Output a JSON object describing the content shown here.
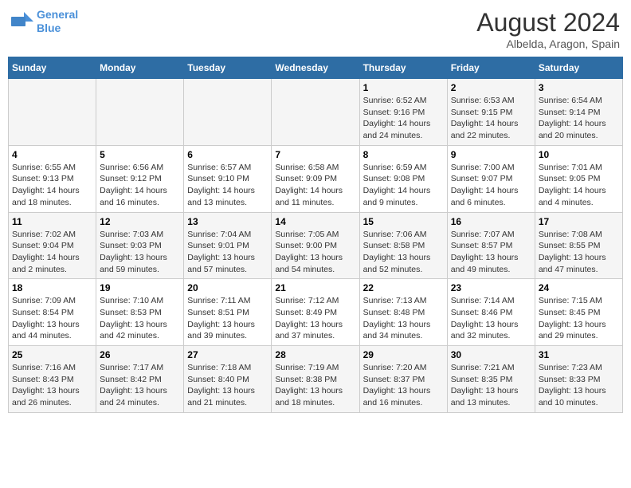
{
  "header": {
    "logo_line1": "General",
    "logo_line2": "Blue",
    "month_year": "August 2024",
    "location": "Albelda, Aragon, Spain"
  },
  "days_of_week": [
    "Sunday",
    "Monday",
    "Tuesday",
    "Wednesday",
    "Thursday",
    "Friday",
    "Saturday"
  ],
  "weeks": [
    [
      {
        "day": "",
        "info": ""
      },
      {
        "day": "",
        "info": ""
      },
      {
        "day": "",
        "info": ""
      },
      {
        "day": "",
        "info": ""
      },
      {
        "day": "1",
        "info": "Sunrise: 6:52 AM\nSunset: 9:16 PM\nDaylight: 14 hours and 24 minutes."
      },
      {
        "day": "2",
        "info": "Sunrise: 6:53 AM\nSunset: 9:15 PM\nDaylight: 14 hours and 22 minutes."
      },
      {
        "day": "3",
        "info": "Sunrise: 6:54 AM\nSunset: 9:14 PM\nDaylight: 14 hours and 20 minutes."
      }
    ],
    [
      {
        "day": "4",
        "info": "Sunrise: 6:55 AM\nSunset: 9:13 PM\nDaylight: 14 hours and 18 minutes."
      },
      {
        "day": "5",
        "info": "Sunrise: 6:56 AM\nSunset: 9:12 PM\nDaylight: 14 hours and 16 minutes."
      },
      {
        "day": "6",
        "info": "Sunrise: 6:57 AM\nSunset: 9:10 PM\nDaylight: 14 hours and 13 minutes."
      },
      {
        "day": "7",
        "info": "Sunrise: 6:58 AM\nSunset: 9:09 PM\nDaylight: 14 hours and 11 minutes."
      },
      {
        "day": "8",
        "info": "Sunrise: 6:59 AM\nSunset: 9:08 PM\nDaylight: 14 hours and 9 minutes."
      },
      {
        "day": "9",
        "info": "Sunrise: 7:00 AM\nSunset: 9:07 PM\nDaylight: 14 hours and 6 minutes."
      },
      {
        "day": "10",
        "info": "Sunrise: 7:01 AM\nSunset: 9:05 PM\nDaylight: 14 hours and 4 minutes."
      }
    ],
    [
      {
        "day": "11",
        "info": "Sunrise: 7:02 AM\nSunset: 9:04 PM\nDaylight: 14 hours and 2 minutes."
      },
      {
        "day": "12",
        "info": "Sunrise: 7:03 AM\nSunset: 9:03 PM\nDaylight: 13 hours and 59 minutes."
      },
      {
        "day": "13",
        "info": "Sunrise: 7:04 AM\nSunset: 9:01 PM\nDaylight: 13 hours and 57 minutes."
      },
      {
        "day": "14",
        "info": "Sunrise: 7:05 AM\nSunset: 9:00 PM\nDaylight: 13 hours and 54 minutes."
      },
      {
        "day": "15",
        "info": "Sunrise: 7:06 AM\nSunset: 8:58 PM\nDaylight: 13 hours and 52 minutes."
      },
      {
        "day": "16",
        "info": "Sunrise: 7:07 AM\nSunset: 8:57 PM\nDaylight: 13 hours and 49 minutes."
      },
      {
        "day": "17",
        "info": "Sunrise: 7:08 AM\nSunset: 8:55 PM\nDaylight: 13 hours and 47 minutes."
      }
    ],
    [
      {
        "day": "18",
        "info": "Sunrise: 7:09 AM\nSunset: 8:54 PM\nDaylight: 13 hours and 44 minutes."
      },
      {
        "day": "19",
        "info": "Sunrise: 7:10 AM\nSunset: 8:53 PM\nDaylight: 13 hours and 42 minutes."
      },
      {
        "day": "20",
        "info": "Sunrise: 7:11 AM\nSunset: 8:51 PM\nDaylight: 13 hours and 39 minutes."
      },
      {
        "day": "21",
        "info": "Sunrise: 7:12 AM\nSunset: 8:49 PM\nDaylight: 13 hours and 37 minutes."
      },
      {
        "day": "22",
        "info": "Sunrise: 7:13 AM\nSunset: 8:48 PM\nDaylight: 13 hours and 34 minutes."
      },
      {
        "day": "23",
        "info": "Sunrise: 7:14 AM\nSunset: 8:46 PM\nDaylight: 13 hours and 32 minutes."
      },
      {
        "day": "24",
        "info": "Sunrise: 7:15 AM\nSunset: 8:45 PM\nDaylight: 13 hours and 29 minutes."
      }
    ],
    [
      {
        "day": "25",
        "info": "Sunrise: 7:16 AM\nSunset: 8:43 PM\nDaylight: 13 hours and 26 minutes."
      },
      {
        "day": "26",
        "info": "Sunrise: 7:17 AM\nSunset: 8:42 PM\nDaylight: 13 hours and 24 minutes."
      },
      {
        "day": "27",
        "info": "Sunrise: 7:18 AM\nSunset: 8:40 PM\nDaylight: 13 hours and 21 minutes."
      },
      {
        "day": "28",
        "info": "Sunrise: 7:19 AM\nSunset: 8:38 PM\nDaylight: 13 hours and 18 minutes."
      },
      {
        "day": "29",
        "info": "Sunrise: 7:20 AM\nSunset: 8:37 PM\nDaylight: 13 hours and 16 minutes."
      },
      {
        "day": "30",
        "info": "Sunrise: 7:21 AM\nSunset: 8:35 PM\nDaylight: 13 hours and 13 minutes."
      },
      {
        "day": "31",
        "info": "Sunrise: 7:23 AM\nSunset: 8:33 PM\nDaylight: 13 hours and 10 minutes."
      }
    ]
  ]
}
